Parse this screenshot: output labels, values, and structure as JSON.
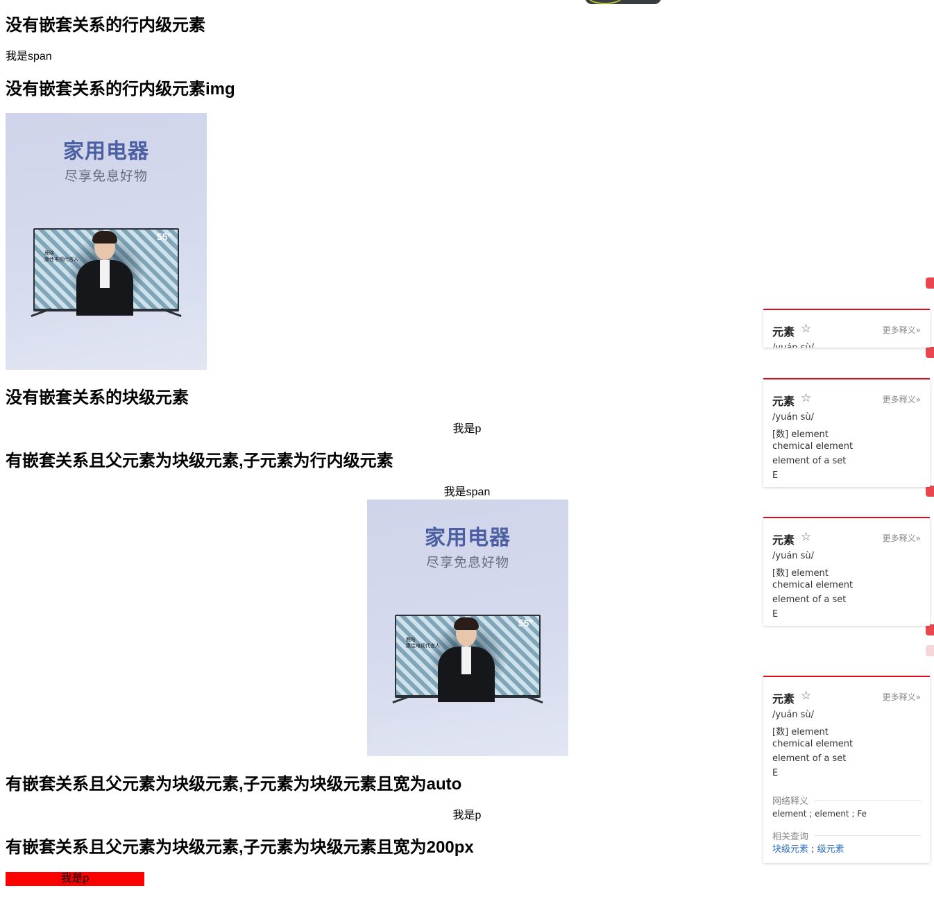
{
  "headings": {
    "h1": "没有嵌套关系的行内级元素",
    "h2": "没有嵌套关系的行内级元素img",
    "h3": "没有嵌套关系的块级元素",
    "h4": "有嵌套关系且父元素为块级元素,子元素为行内级元素",
    "h5": "有嵌套关系且父元素为块级元素,子元素为块级元素且宽为auto",
    "h6": "有嵌套关系且父元素为块级元素,子元素为块级元素且宽为200px"
  },
  "texts": {
    "span1": "我是span",
    "p1": "我是p",
    "span2": "我是span",
    "p2": "我是p",
    "p3": "我是p"
  },
  "ad": {
    "title": "家用电器",
    "subtitle": "尽享免息好物",
    "tv_size": "55\"",
    "tv_caption_1": "鹿晗",
    "tv_caption_2": "康佳电视代言人"
  },
  "dictionary": {
    "headword": "元素",
    "star": "☆",
    "more": "更多释义»",
    "pinyin": "/yuán sù/",
    "defs": [
      "[数] element",
      "chemical element",
      "element of a set",
      "E"
    ],
    "web_title": "网络释义",
    "web_defs": "element ; element ; Fe",
    "related_title": "相关查询",
    "related_1": "块级元素",
    "related_sep": " ; ",
    "related_2": "级元素"
  },
  "colors": {
    "accent_red": "#d6101e",
    "box_red": "#ff0000",
    "link_blue": "#2a6ebc"
  }
}
